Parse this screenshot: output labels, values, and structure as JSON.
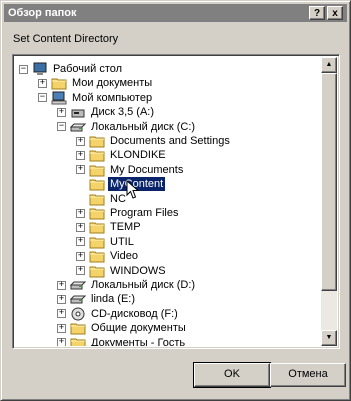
{
  "titlebar": {
    "title": "Обзор папок",
    "help_label": "?",
    "close_label": "x"
  },
  "dialog": {
    "instruction": "Set Content Directory"
  },
  "tree": {
    "items": [
      {
        "label": "Рабочий стол",
        "expander": "−",
        "icon": "desktop-icon"
      },
      {
        "label": "Мои документы",
        "expander": "+",
        "icon": "folder-icon"
      },
      {
        "label": "Мой компьютер",
        "expander": "−",
        "icon": "computer-icon"
      },
      {
        "label": "Диск 3,5 (A:)",
        "expander": "+",
        "icon": "floppy-icon"
      },
      {
        "label": "Локальный диск (C:)",
        "expander": "−",
        "icon": "drive-icon"
      },
      {
        "label": "Documents and Settings",
        "expander": "+",
        "icon": "folder-icon"
      },
      {
        "label": "KLONDIKE",
        "expander": "+",
        "icon": "folder-icon"
      },
      {
        "label": "My Documents",
        "expander": "+",
        "icon": "folder-icon"
      },
      {
        "label": "MyContent",
        "expander": "",
        "icon": "folder-icon",
        "selected": true
      },
      {
        "label": "NC",
        "expander": "",
        "icon": "folder-icon"
      },
      {
        "label": "Program Files",
        "expander": "+",
        "icon": "folder-icon"
      },
      {
        "label": "TEMP",
        "expander": "+",
        "icon": "folder-icon"
      },
      {
        "label": "UTIL",
        "expander": "+",
        "icon": "folder-icon"
      },
      {
        "label": "Video",
        "expander": "+",
        "icon": "folder-icon"
      },
      {
        "label": "WINDOWS",
        "expander": "+",
        "icon": "folder-icon"
      },
      {
        "label": "Локальный диск (D:)",
        "expander": "+",
        "icon": "drive-icon"
      },
      {
        "label": "linda (E:)",
        "expander": "+",
        "icon": "drive-icon"
      },
      {
        "label": "CD-дисковод (F:)",
        "expander": "+",
        "icon": "cd-icon"
      },
      {
        "label": "Общие документы",
        "expander": "+",
        "icon": "folder-icon"
      },
      {
        "label": "Документы - Гость",
        "expander": "+",
        "icon": "folder-icon"
      }
    ]
  },
  "buttons": {
    "ok_label": "OK",
    "cancel_label": "Отмена"
  },
  "colors": {
    "selection": "#0a246a",
    "titlebar": "#808080",
    "face": "#d4d0c8"
  }
}
